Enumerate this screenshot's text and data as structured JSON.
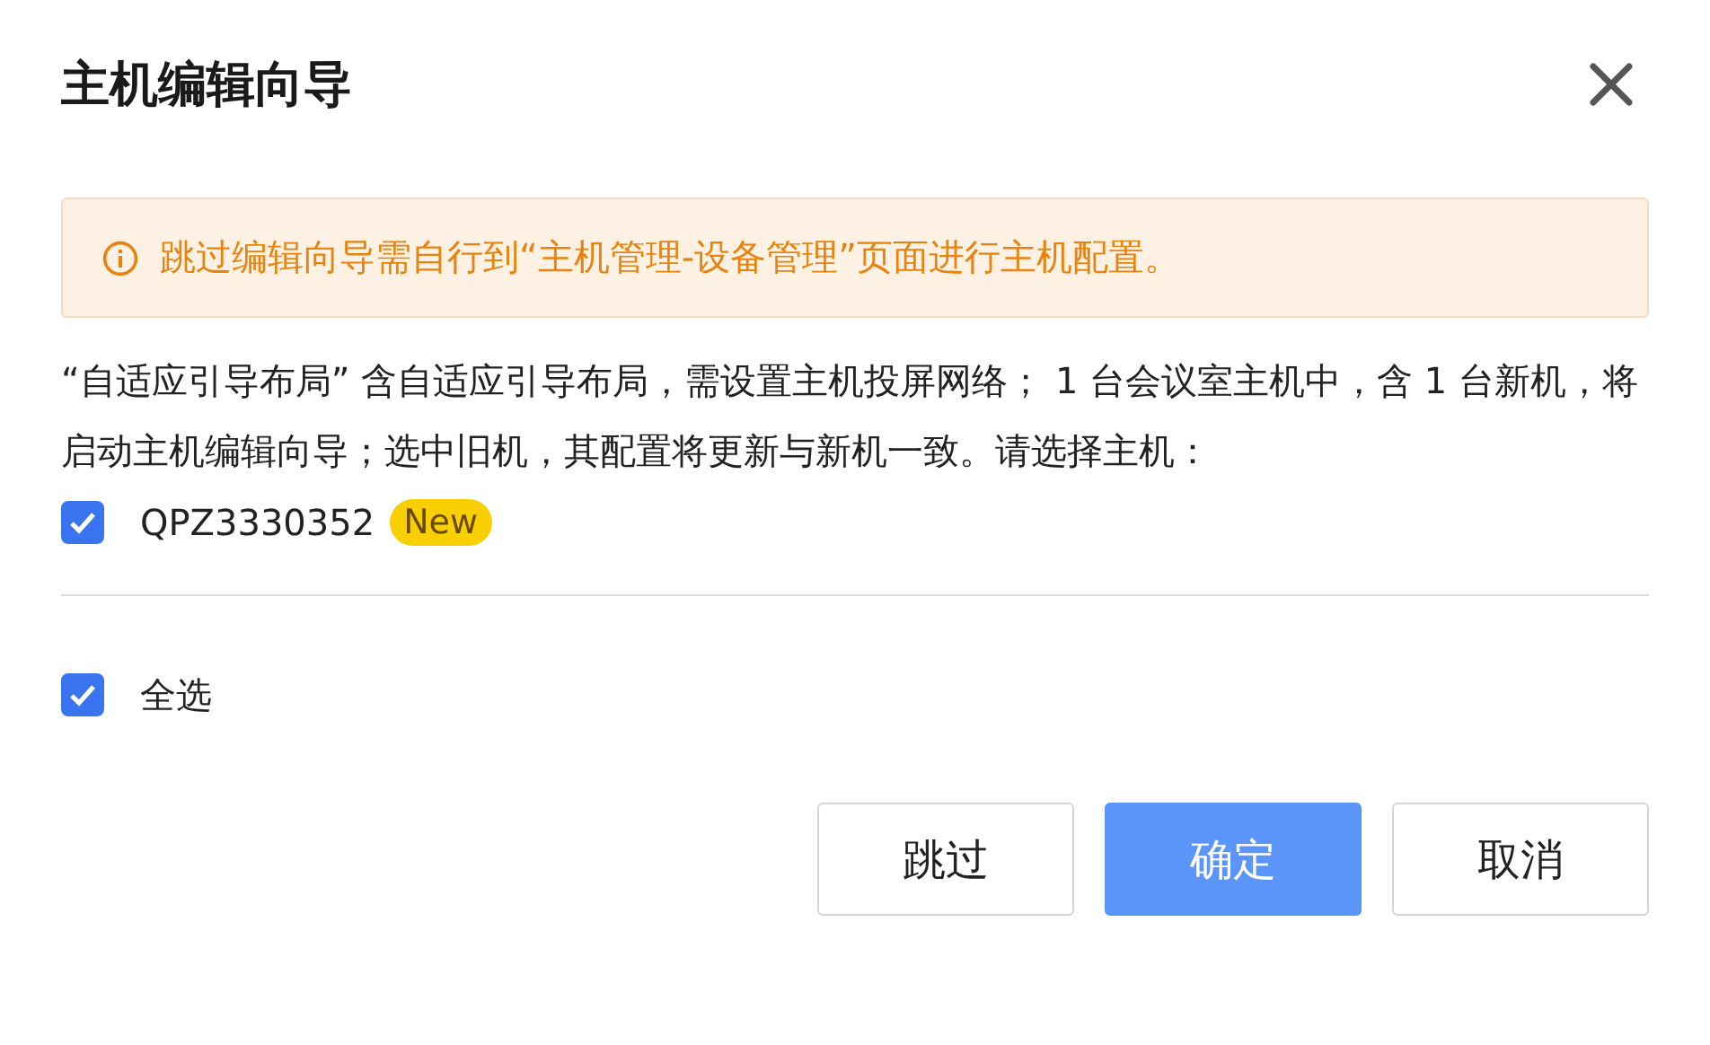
{
  "dialog": {
    "title": "主机编辑向导"
  },
  "notice": {
    "text": "跳过编辑向导需自行到“主机管理-设备管理”页面进行主机配置。"
  },
  "description": "“自适应引导布局” 含自适应引导布局，需设置主机投屏网络； 1 台会议室主机中，含 1 台新机，将启动主机编辑向导；选中旧机，其配置将更新与新机一致。请选择主机：",
  "hosts": [
    {
      "name": "QPZ3330352",
      "checked": true,
      "badge": "New"
    }
  ],
  "select_all": {
    "label": "全选",
    "checked": true
  },
  "buttons": [
    {
      "label": "跳过",
      "kind": "default"
    },
    {
      "label": "确定",
      "kind": "primary"
    },
    {
      "label": "取消",
      "kind": "default"
    }
  ]
}
